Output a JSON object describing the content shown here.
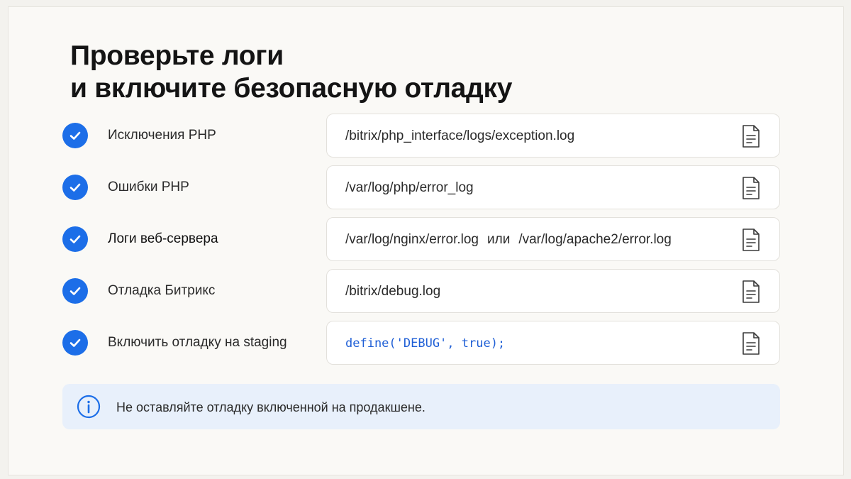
{
  "title": {
    "line1": "Проверьте логи",
    "line2": "и включите безопасную отладку"
  },
  "rows": [
    {
      "label": "Исключения PHP",
      "path": "/bitrix/php_interface/logs/exception.log",
      "icon": "check-icon",
      "file_icon": "document-icon"
    },
    {
      "label": "Ошибки PHP",
      "path": "/var/log/php/error_log",
      "icon": "check-icon",
      "file_icon": "document-icon"
    },
    {
      "label": "Логи веб-сервера",
      "path_a": "/var/log/nginx/error.log",
      "path_sep": "или",
      "path_b": "/var/log/apache2/error.log",
      "icon": "check-icon",
      "file_icon": "document-icon"
    },
    {
      "label": "Отладка Битрикс",
      "path": "/bitrix/debug.log",
      "icon": "check-icon",
      "file_icon": "document-icon"
    },
    {
      "label": "Включить отладку на staging",
      "code": "define('DEBUG', true);",
      "icon": "check-icon",
      "file_icon": "document-icon"
    }
  ],
  "notice": {
    "icon": "info-icon",
    "text": "Не оставляйте отладку включенной на продакшене."
  },
  "colors": {
    "accent": "#1c6ee8",
    "code": "#1f5fd6",
    "notice_bg": "#e8f0fb",
    "background": "#faf9f6"
  }
}
